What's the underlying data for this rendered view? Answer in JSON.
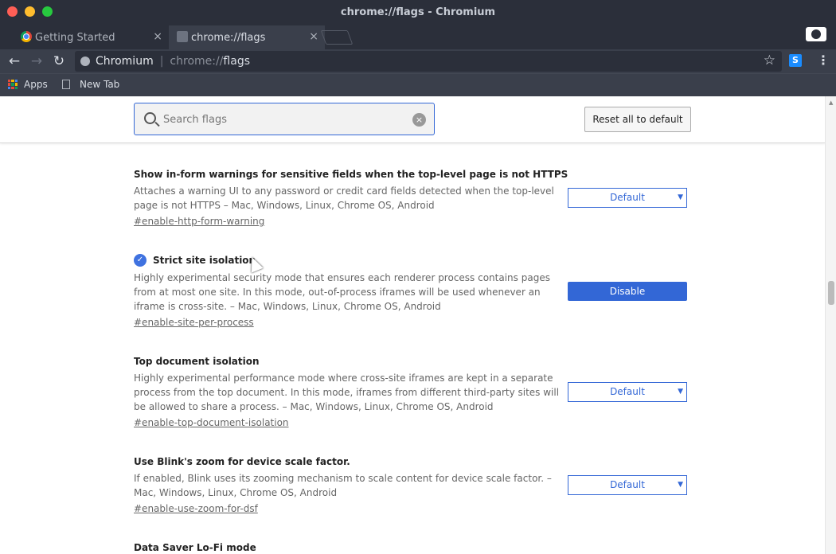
{
  "window": {
    "title": "chrome://flags - Chromium"
  },
  "tabs": [
    {
      "label": "Getting Started",
      "icon": "chrome-icon",
      "active": false
    },
    {
      "label": "chrome://flags",
      "icon": "flask-icon",
      "active": true
    }
  ],
  "tab_close_glyph": "×",
  "toolbar": {
    "back_glyph": "←",
    "forward_glyph": "→",
    "reload_glyph": "↻",
    "site_name": "Chromium",
    "url_scheme": "chrome://",
    "url_path": "flags",
    "star_glyph": "☆",
    "extension_label": "S",
    "menu_glyph": "⋮"
  },
  "bookmarks": [
    {
      "label": "Apps",
      "icon": "apps-grid-icon"
    },
    {
      "label": "New Tab",
      "icon": "page-icon"
    }
  ],
  "search": {
    "placeholder": "Search flags",
    "value": "",
    "clear_glyph": "×"
  },
  "reset_button_label": "Reset all to default",
  "flags": [
    {
      "title": "Show in-form warnings for sensitive fields when the top-level page is not HTTPS",
      "description": "Attaches a warning UI to any password or credit card fields detected when the top-level page is not HTTPS  – Mac, Windows, Linux, Chrome OS, Android",
      "link": "#enable-http-form-warning",
      "control": "select",
      "value": "Default",
      "enabled": false
    },
    {
      "title": "Strict site isolation",
      "description": "Highly experimental security mode that ensures each renderer process contains pages from at most one site. In this mode, out-of-process iframes will be used whenever an iframe is cross-site.  – Mac, Windows, Linux, Chrome OS, Android",
      "link": "#enable-site-per-process",
      "control": "button",
      "value": "Disable",
      "enabled": true
    },
    {
      "title": "Top document isolation",
      "description": "Highly experimental performance mode where cross-site iframes are kept in a separate process from the top document. In this mode, iframes from different third-party sites will be allowed to share a process.  – Mac, Windows, Linux, Chrome OS, Android",
      "link": "#enable-top-document-isolation",
      "control": "select",
      "value": "Default",
      "enabled": false
    },
    {
      "title": "Use Blink's zoom for device scale factor.",
      "description": "If enabled, Blink uses its zooming mechanism to scale content for device scale factor.  – Mac, Windows, Linux, Chrome OS, Android",
      "link": "#enable-use-zoom-for-dsf",
      "control": "select",
      "value": "Default",
      "enabled": false
    },
    {
      "title": "Data Saver Lo-Fi mode",
      "description": "",
      "link": "",
      "control": "none",
      "value": "",
      "enabled": false
    }
  ],
  "select_arrow_glyph": "▼",
  "check_glyph": "✓",
  "colors": {
    "accent": "#3367d6",
    "titlebar": "#2b2f3a",
    "toolbar": "#3a3f4b"
  }
}
